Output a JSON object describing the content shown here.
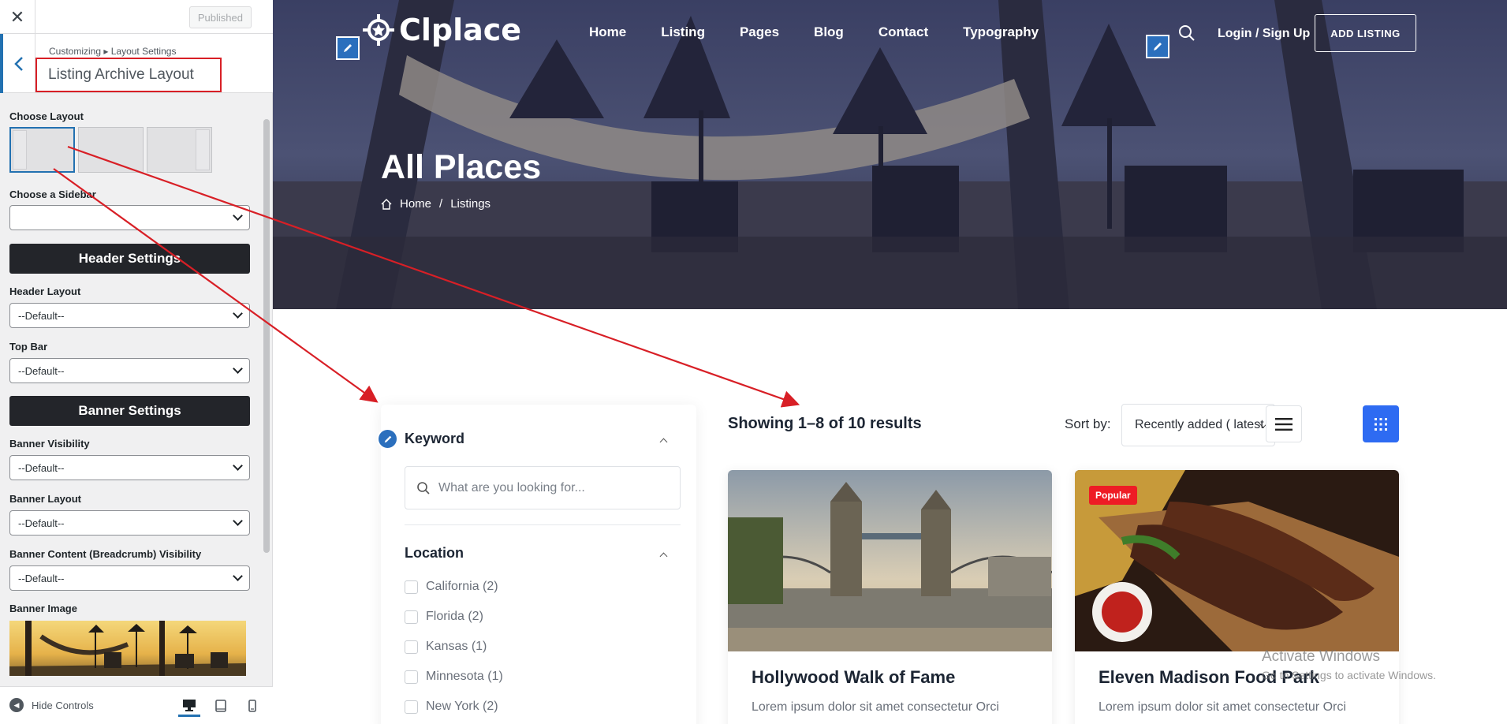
{
  "customizer": {
    "published_label": "Published",
    "breadcrumb": "Customizing ▸ Layout Settings",
    "section_title": "Listing Archive Layout",
    "choose_layout_label": "Choose Layout",
    "choose_sidebar_label": "Choose a Sidebar",
    "sidebar_value": "",
    "header_settings_label": "Header Settings",
    "header_layout_label": "Header Layout",
    "header_layout_value": "--Default--",
    "top_bar_label": "Top Bar",
    "top_bar_value": "--Default--",
    "banner_settings_label": "Banner Settings",
    "banner_visibility_label": "Banner Visibility",
    "banner_visibility_value": "--Default--",
    "banner_layout_label": "Banner Layout",
    "banner_layout_value": "--Default--",
    "banner_content_label": "Banner Content (Breadcrumb) Visibility",
    "banner_content_value": "--Default--",
    "banner_image_label": "Banner Image",
    "hide_controls_label": "Hide Controls"
  },
  "site": {
    "logo_text": "Clplace",
    "nav": [
      "Home",
      "Listing",
      "Pages",
      "Blog",
      "Contact",
      "Typography"
    ],
    "login_label": "Login / Sign Up",
    "add_listing_label": "ADD LISTING",
    "hero_title": "All Places",
    "breadcrumb_home": "Home",
    "breadcrumb_sep": "/",
    "breadcrumb_current": "Listings"
  },
  "filters": {
    "keyword_title": "Keyword",
    "search_placeholder": "What are you looking for...",
    "location_title": "Location",
    "locations": [
      "California (2)",
      "Florida (2)",
      "Kansas (1)",
      "Minnesota (1)",
      "New York (2)"
    ]
  },
  "listing": {
    "results_text": "Showing 1–8 of 10 results",
    "sort_label": "Sort by:",
    "sort_value": "Recently added ( latest )",
    "cards": [
      {
        "title": "Hollywood Walk of Fame",
        "desc": "Lorem ipsum dolor sit amet consectetur Orci",
        "badge": ""
      },
      {
        "title": "Eleven Madison Food Park",
        "desc": "Lorem ipsum dolor sit amet consectetur Orci",
        "badge": "Popular"
      }
    ]
  },
  "watermark": {
    "line1": "Activate Windows",
    "line2": "Go to Settings to activate Windows."
  },
  "colors": {
    "accent_blue": "#2e6bf2",
    "wp_blue": "#2271b1",
    "annotation_red": "#d81f26",
    "dark_button": "#23252a"
  }
}
